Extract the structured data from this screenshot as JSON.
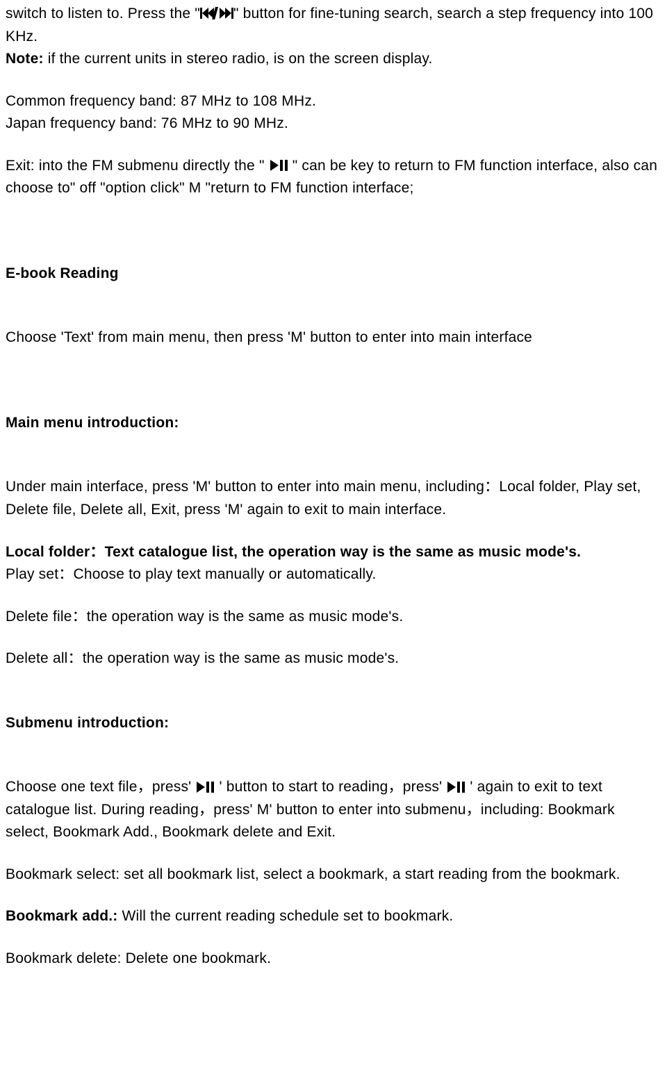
{
  "p1a": "switch to listen to. Press the \"",
  "p1b": "\" button for fine-tuning search, search a step frequency into 100 KHz.",
  "noteLabel": "Note:",
  "noteText": " if the current units in stereo radio, is on the screen display.",
  "commonBand": "Common frequency band: 87 MHz to 108 MHz.",
  "japanBand": "Japan frequency band: 76 MHz to 90 MHz.",
  "exitA": "Exit: into the FM submenu directly the \" ",
  "exitB": " \" can be key to return to FM function interface, also can choose to\" off \"option click\" M \"return to FM function interface;",
  "ebookHeading": "E-book Reading",
  "ebookIntro": "Choose 'Text' from main menu, then press 'M' button to enter into main interface",
  "mainMenuHeading": "Main menu introduction:",
  "mainMenuA": "Under main interface, press 'M' button to enter into main menu, including：",
  "mainMenuB": "Local folder, Play set, Delete file, Delete all, Exit, press 'M' again to exit to main interface.",
  "localFolder": "Local folder：Text catalogue list, the operation way is the same as music mode's.",
  "playSet": "Play set：Choose to play text manually or automatically.",
  "deleteFile": "Delete file：the operation way is the same as music mode's.",
  "deleteAll": "Delete all：the operation way is the same as music mode's.",
  "submenuHeading": "Submenu introduction:",
  "subA": "Choose one text file，press' ",
  "subB": " ' button to start to reading，press' ",
  "subC": " ' again to exit to text catalogue list. During reading，press' M' button to enter into submenu，including: Bookmark select, Bookmark Add., Bookmark delete and Exit.",
  "bookmarkSelect": "Bookmark select: set all bookmark list, select a bookmark, a start reading from the bookmark.",
  "bookmarkAddLabel": "Bookmark add.:",
  "bookmarkAddText": " Will the current reading schedule set to bookmark.",
  "bookmarkDelete": "Bookmark delete: Delete one bookmark."
}
